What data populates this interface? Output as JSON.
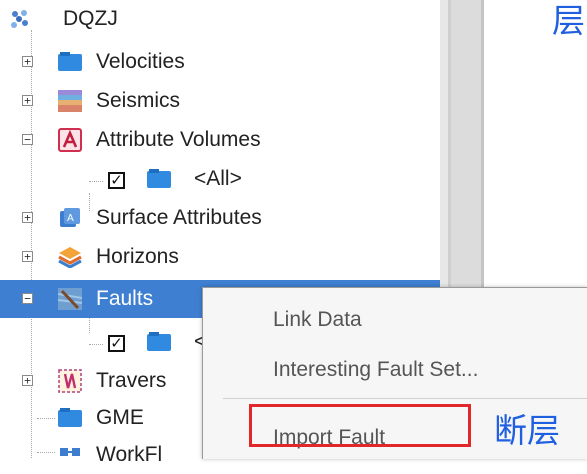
{
  "tree": {
    "root": {
      "label": "DQZJ",
      "icon": "project-icon"
    },
    "items": [
      {
        "label": "Velocities",
        "icon": "folder-icon",
        "expander": "+"
      },
      {
        "label": "Seismics",
        "icon": "seismic-icon",
        "expander": "+"
      },
      {
        "label": "Attribute Volumes",
        "icon": "attribute-volume-icon",
        "expander": "−"
      },
      {
        "label": "<All>",
        "icon": "folder-icon",
        "checked": true
      },
      {
        "label": "Surface Attributes",
        "icon": "surface-attribute-icon",
        "expander": "+"
      },
      {
        "label": "Horizons",
        "icon": "horizons-icon",
        "expander": "+"
      },
      {
        "label": "Faults",
        "icon": "faults-icon",
        "expander": "−",
        "selected": true
      },
      {
        "label": "<",
        "icon": "folder-icon",
        "checked": true
      },
      {
        "label": "Travers",
        "icon": "traverse-icon",
        "expander": "+"
      },
      {
        "label": "GME",
        "icon": "folder-icon"
      },
      {
        "label": "WorkFl",
        "icon": "workflow-icon"
      }
    ]
  },
  "context_menu": {
    "items": [
      {
        "label": "Link Data"
      },
      {
        "label": "Interesting Fault Set..."
      },
      {
        "label": "Import Fault"
      }
    ]
  },
  "annotations": {
    "top": "层",
    "bottom": "断层"
  },
  "colors": {
    "selection": "#3f7fd1",
    "highlight_box": "#e3262a",
    "annotation_text": "#1f5fe0"
  }
}
